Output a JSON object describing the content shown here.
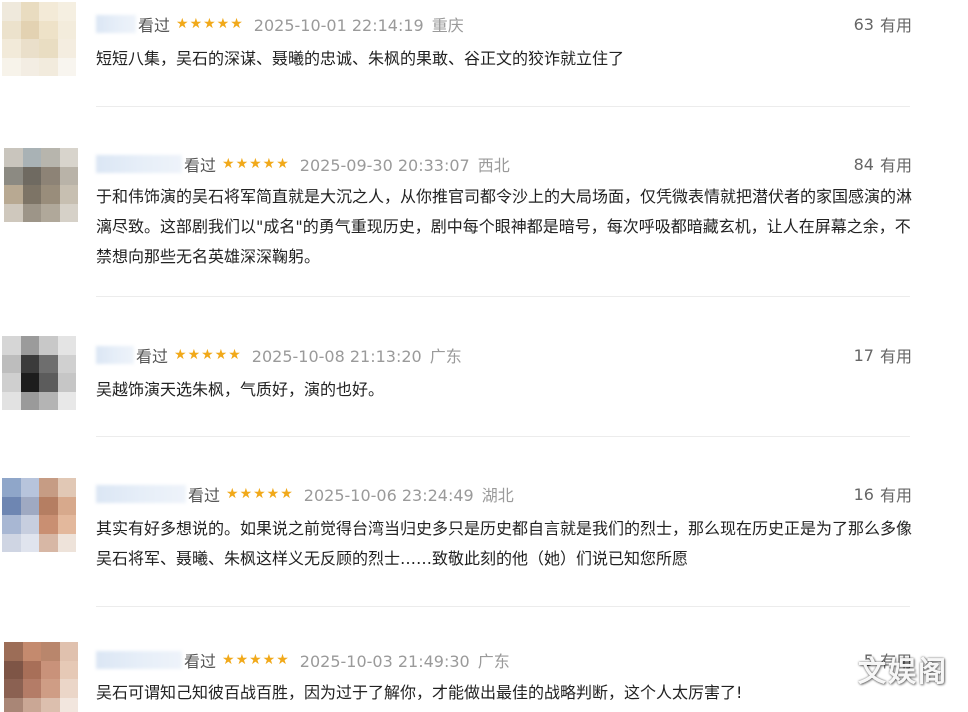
{
  "reviews": [
    {
      "status": "看过",
      "stars": "★★★★★",
      "datetime": "2025-10-01 22:14:19",
      "location": "重庆",
      "useful_count": "63",
      "useful_label": "有用",
      "content": "短短八集，吴石的深谋、聂曦的忠诚、朱枫的果敢、谷正文的狡诈就立住了",
      "avatar_colors": [
        "#efe9dc",
        "#e9dcc0",
        "#f3ead7",
        "#f5efe1",
        "#ece2cc",
        "#e3d2b2",
        "#eee2c8",
        "#f3ecdc",
        "#f2ead9",
        "#eadfca",
        "#e9ddc2",
        "#f4ede0",
        "#f7f3ea",
        "#f3ede3",
        "#f2ebdd",
        "#f8f5ef"
      ]
    },
    {
      "status": "看过",
      "stars": "★★★★★",
      "datetime": "2025-09-30 20:33:07",
      "location": "西北",
      "useful_count": "84",
      "useful_label": "有用",
      "content": "于和伟饰演的吴石将军简直就是大沉之人，从你推官司都令沙上的大局场面，仅凭微表情就把潜伏者的家国感演的淋漓尽致。这部剧我们以\"成名\"的勇气重现历史，剧中每个眼神都是暗号，每次呼吸都暗藏玄机，让人在屏幕之余，不禁想向那些无名英雄深深鞠躬。",
      "avatar_colors": [
        "#c9c5bd",
        "#a9b2b5",
        "#b7b5ad",
        "#d8d4cc",
        "#8c8a82",
        "#6f6a61",
        "#8d8376",
        "#b9b3a8",
        "#b8a992",
        "#7d7466",
        "#998d7b",
        "#c7bfb1",
        "#cfc8bd",
        "#9d9588",
        "#b0a89a",
        "#d6d1c8"
      ]
    },
    {
      "status": "看过",
      "stars": "★★★★★",
      "datetime": "2025-10-08 21:13:20",
      "location": "广东",
      "useful_count": "17",
      "useful_label": "有用",
      "content": "吴越饰演天选朱枫，气质好，演的也好。",
      "avatar_colors": [
        "#d6d6d6",
        "#9b9b9b",
        "#c8c8c8",
        "#e4e4e4",
        "#bdbdbd",
        "#3b3b3b",
        "#6e6e6e",
        "#d0d0d0",
        "#cfcfcf",
        "#1d1d1d",
        "#5c5c5c",
        "#c6c6c6",
        "#e2e2e2",
        "#9a9a9a",
        "#b4b4b4",
        "#e8e8e8"
      ]
    },
    {
      "status": "看过",
      "stars": "★★★★★",
      "datetime": "2025-10-06 23:24:49",
      "location": "湖北",
      "useful_count": "16",
      "useful_label": "有用",
      "content": "其实有好多想说的。如果说之前觉得台湾当归史多只是历史都自言就是我们的烈士，那么现在历史正是为了那么多像吴石将军、聂曦、朱枫这样义无反顾的烈士……致敬此刻的他（她）们说已知您所愿",
      "avatar_colors": [
        "#8fa6c9",
        "#b7c4dc",
        "#c69c84",
        "#e1c8b5",
        "#6e86b2",
        "#9fa9c2",
        "#b57e62",
        "#d7a98c",
        "#a8b7d3",
        "#c7cedf",
        "#c98f72",
        "#e3b89c",
        "#cfd5e3",
        "#e0e4ee",
        "#d7b7a5",
        "#eee3da"
      ]
    },
    {
      "status": "看过",
      "stars": "★★★★★",
      "datetime": "2025-10-03 21:49:30",
      "location": "广东",
      "useful_count": "5",
      "useful_label": "有用",
      "content": "吴石可谓知己知彼百战百胜，因为过于了解你，才能做出最佳的战略判断，这个人太厉害了!",
      "avatar_colors": [
        "#9c6d57",
        "#c48a6e",
        "#b9866c",
        "#e0c1ae",
        "#7e5546",
        "#a86f58",
        "#c9927a",
        "#e6c9b6",
        "#8b6152",
        "#b47c67",
        "#cf9d85",
        "#ebd6c8",
        "#a98676",
        "#caa795",
        "#dcbfae",
        "#f2e6de"
      ]
    }
  ],
  "watermark": "文娱阁"
}
